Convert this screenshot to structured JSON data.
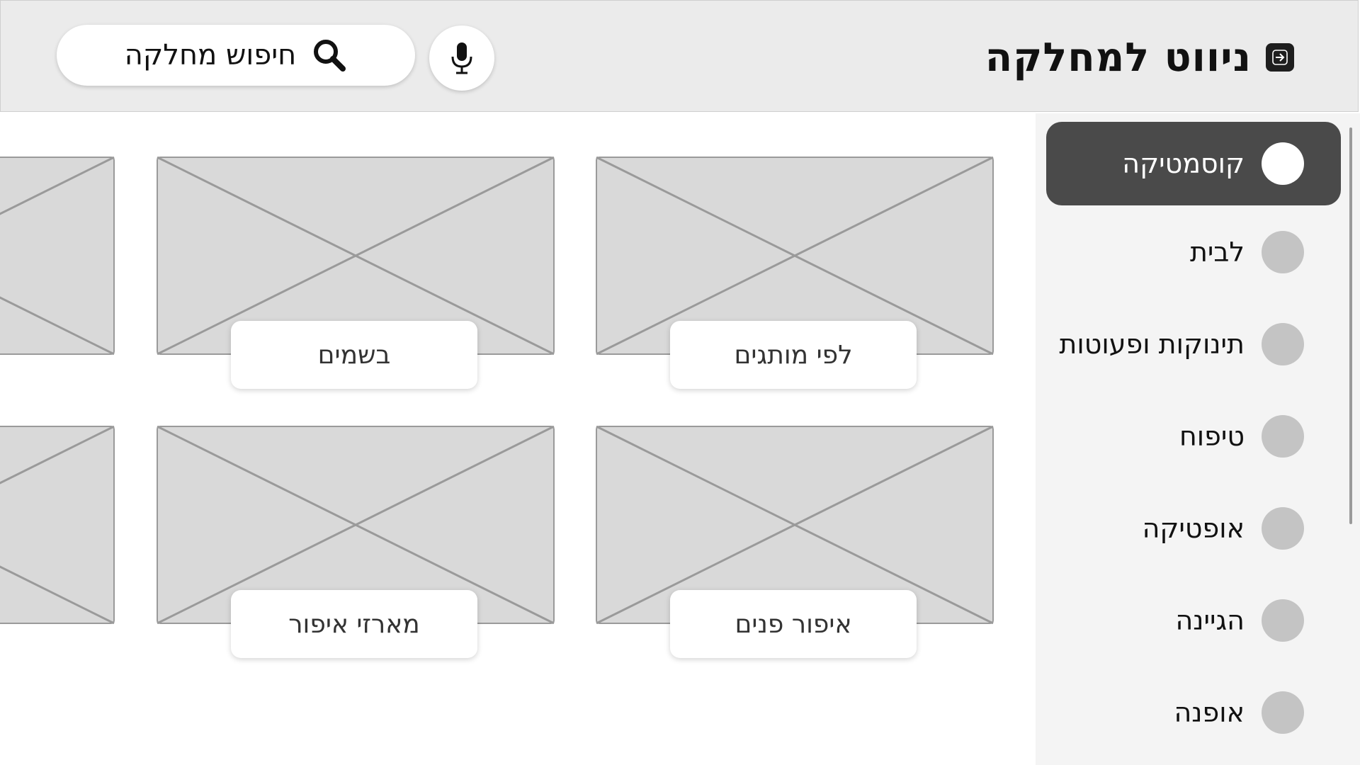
{
  "header": {
    "title": "ניווט למחלקה",
    "search_placeholder": "חיפוש מחלקה",
    "back_icon": "arrow-right-icon",
    "mic_icon": "microphone-icon",
    "search_icon": "magnifier-icon"
  },
  "sidebar": {
    "items": [
      {
        "label": "קוסמטיקה",
        "active": true
      },
      {
        "label": "לבית",
        "active": false
      },
      {
        "label": "תינוקות ופעוטות",
        "active": false
      },
      {
        "label": "טיפוח",
        "active": false
      },
      {
        "label": "אופטיקה",
        "active": false
      },
      {
        "label": "הגיינה",
        "active": false
      },
      {
        "label": "אופנה",
        "active": false
      }
    ]
  },
  "grid": {
    "cards": [
      {
        "label": "לפי מותגים"
      },
      {
        "label": "בשמים"
      },
      {
        "label": "איפור פנים"
      },
      {
        "label": "מארזי איפור"
      }
    ]
  },
  "colors": {
    "header_bg": "#ebebeb",
    "active_item_bg": "#4a4a4a",
    "placeholder_fill": "#d9d9d9",
    "placeholder_stroke": "#9a9a9a"
  }
}
